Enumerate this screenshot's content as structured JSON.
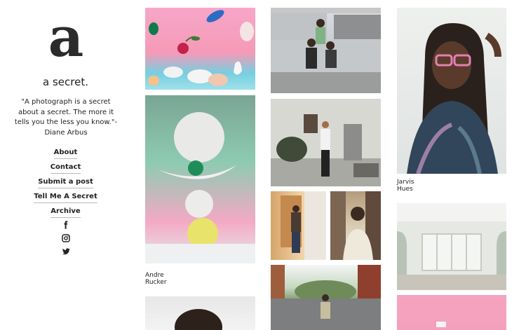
{
  "blog": {
    "logo": "a",
    "title": "a secret.",
    "quote": "\"A photograph is a secret about a secret. The more it tells you the less you know.\"- Diane Arbus"
  },
  "nav": {
    "about": "About",
    "contact": "Contact",
    "submit": "Submit a post",
    "tell": "Tell Me A Secret",
    "archive": "Archive"
  },
  "social": [
    "facebook-icon",
    "instagram-icon",
    "twitter-icon"
  ],
  "captions": {
    "andre": "Andre Rucker",
    "jarvis": "Jarvis Hues"
  }
}
